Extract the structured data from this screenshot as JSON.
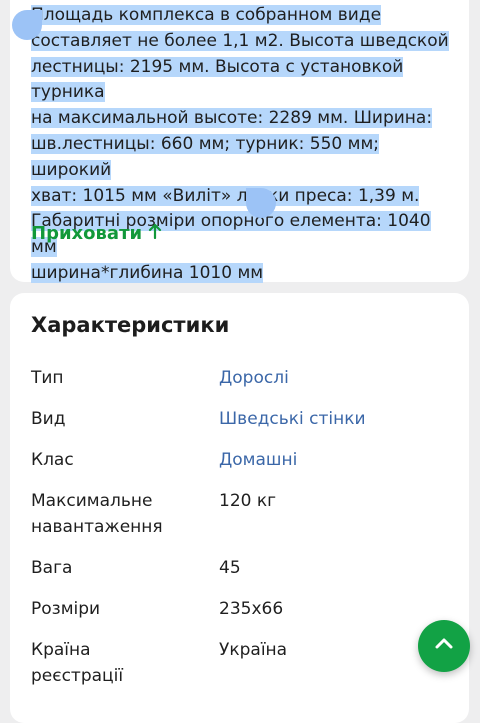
{
  "description": {
    "lines": [
      "Площадь комплекса в собранном виде",
      "составляет не более 1,1 м2. Высота шведской",
      "лестницы: 2195 мм. Высота с установкой турника",
      "на максимальной высоте: 2289 мм. Ширина:",
      "шв.лестницы: 660 мм; турник: 550 мм; широкий",
      "хват: 1015 мм «Виліт» лавки преса: 1,39 м.",
      "Габаритні розміри опорного елемента: 1040 мм",
      "ширина*глибина 1010 мм"
    ],
    "hide_label": "Приховати",
    "hide_icon": "arrow-up-icon",
    "highlight_color": "#b6d7fb"
  },
  "characteristics": {
    "title": "Характеристики",
    "rows": [
      {
        "label": "Тип",
        "value": "Дорослі",
        "is_link": true
      },
      {
        "label": "Вид",
        "value": "Шведські стінки",
        "is_link": true
      },
      {
        "label": "Клас",
        "value": "Домашні",
        "is_link": true
      },
      {
        "label": "Максимальне навантаження",
        "value": "120 кг",
        "is_link": false
      },
      {
        "label": "Вага",
        "value": "45",
        "is_link": false
      },
      {
        "label": "Розміри",
        "value": "235x66",
        "is_link": false
      },
      {
        "label": "Країна реєстрації",
        "value": "Україна",
        "is_link": false
      }
    ]
  },
  "scroll_top_button": {
    "icon": "chevron-up-icon"
  },
  "colors": {
    "accent_green": "#12983a",
    "link_blue": "#3b67a8",
    "fab_green": "#12a245",
    "page_bg": "#eeeeef"
  }
}
